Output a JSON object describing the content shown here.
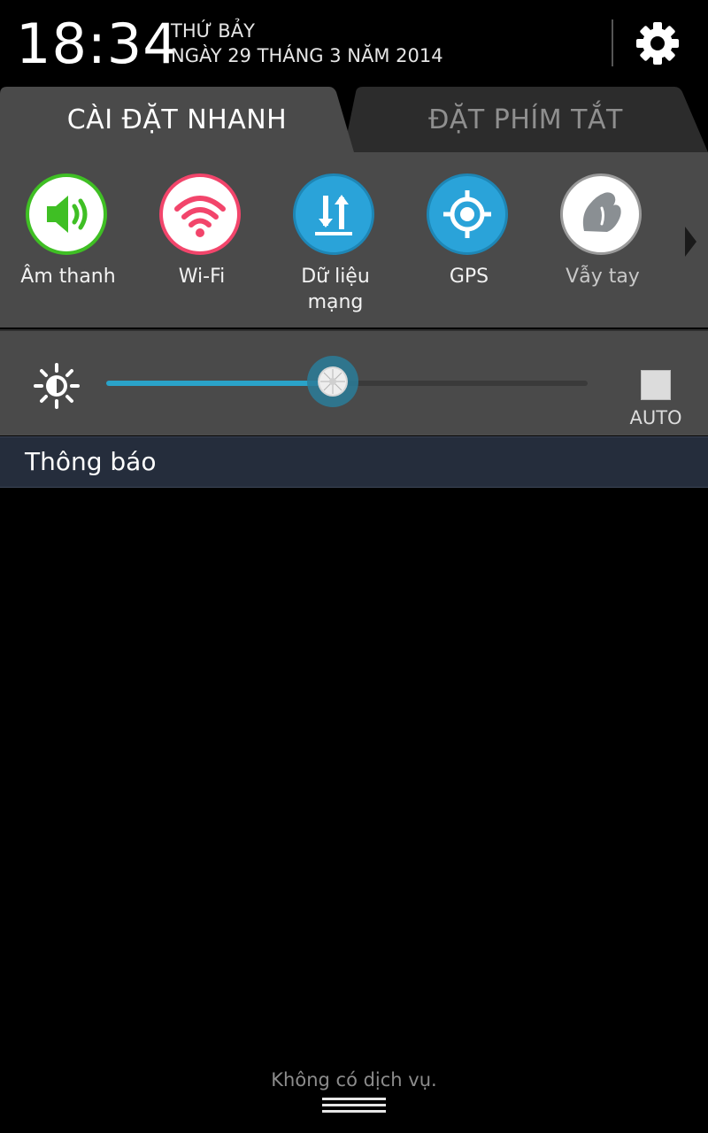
{
  "header": {
    "time": "18:34",
    "day": "THỨ BẢY",
    "date": "NGÀY 29 THÁNG 3 NĂM 2014",
    "settings_icon": "gear-icon"
  },
  "tabs": [
    {
      "label": "CÀI ĐẶT NHANH",
      "active": true
    },
    {
      "label": "ĐẶT PHÍM TẮT",
      "active": false
    }
  ],
  "quick_settings": [
    {
      "label": "Âm thanh",
      "icon": "speaker-icon",
      "enabled": true,
      "color": "#3fbf24"
    },
    {
      "label": "Wi-Fi",
      "icon": "wifi-icon",
      "enabled": true,
      "color": "#f2456b"
    },
    {
      "label": "Dữ liệu mạng",
      "label_line1": "Dữ liệu",
      "label_line2": "mạng",
      "icon": "mobile-data-icon",
      "enabled": true,
      "color": "#2aa3d9"
    },
    {
      "label": "GPS",
      "icon": "gps-icon",
      "enabled": true,
      "color": "#2aa3d9"
    },
    {
      "label": "Vẫy tay",
      "icon": "hand-wave-icon",
      "enabled": false,
      "color": "#ffffff"
    }
  ],
  "brightness": {
    "level_percent": 47,
    "auto_label": "AUTO",
    "auto_checked": false,
    "accent": "#2aa3c9"
  },
  "notifications": {
    "title": "Thông báo"
  },
  "footer": {
    "carrier_text": "Không có dịch vụ."
  }
}
